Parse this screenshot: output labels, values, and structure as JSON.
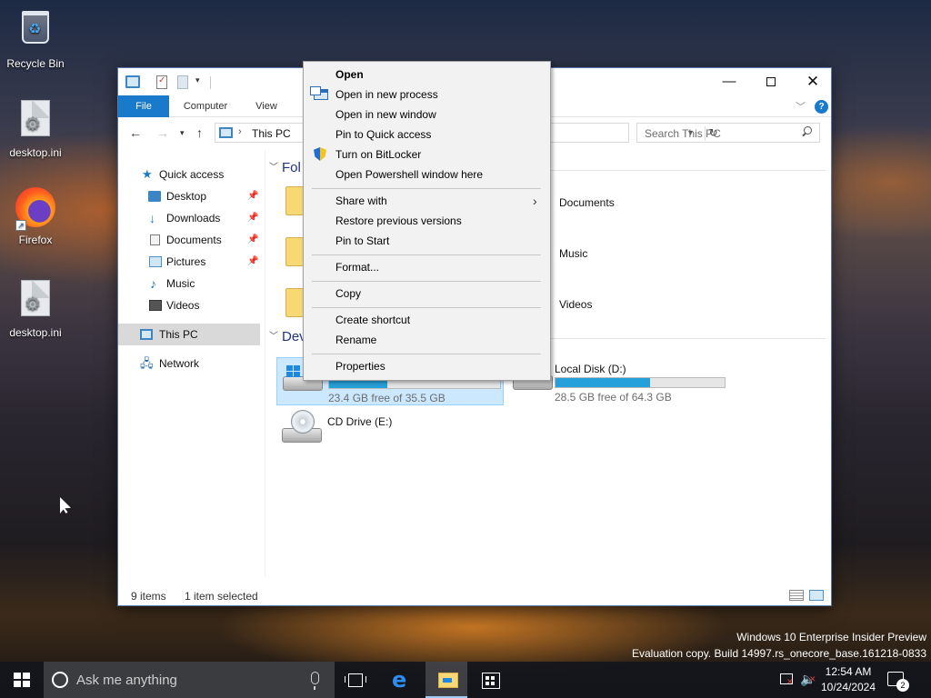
{
  "desktop": {
    "icons": [
      {
        "label": "Recycle Bin"
      },
      {
        "label": "desktop.ini"
      },
      {
        "label": "Firefox"
      },
      {
        "label": "desktop.ini"
      }
    ]
  },
  "explorer": {
    "ribbon_tabs": [
      "File",
      "Computer",
      "View"
    ],
    "address": {
      "path": "This PC"
    },
    "search": {
      "placeholder": "Search This PC"
    },
    "nav": {
      "quick_access": "Quick access",
      "items": [
        "Desktop",
        "Downloads",
        "Documents",
        "Pictures",
        "Music",
        "Videos"
      ],
      "this_pc": "This PC",
      "network": "Network"
    },
    "groups": {
      "folders_visible": "Fol",
      "devices_visible": "Dev"
    },
    "folders": [
      "Documents",
      "Music",
      "Videos"
    ],
    "drives": [
      {
        "name": "",
        "free": "23.4 GB free of 35.5 GB",
        "used_fraction": 0.34,
        "selected": true
      },
      {
        "name": "Local Disk (D:)",
        "free": "28.5 GB free of 64.3 GB",
        "used_fraction": 0.56,
        "selected": false
      },
      {
        "name": "CD Drive (E:)",
        "free": "",
        "selected": false
      }
    ],
    "status": {
      "items": "9 items",
      "selected": "1 item selected"
    }
  },
  "context_menu": {
    "items": [
      {
        "label": "Open",
        "bold": true
      },
      {
        "label": "Open in new process",
        "icon": "process-icon"
      },
      {
        "label": "Open in new window"
      },
      {
        "label": "Pin to Quick access"
      },
      {
        "label": "Turn on BitLocker",
        "icon": "shield-icon"
      },
      {
        "label": "Open Powershell window here"
      },
      {
        "label": "Share with",
        "submenu": true
      },
      {
        "label": "Restore previous versions"
      },
      {
        "label": "Pin to Start"
      },
      {
        "label": "Format..."
      },
      {
        "label": "Copy"
      },
      {
        "label": "Create shortcut"
      },
      {
        "label": "Rename"
      },
      {
        "label": "Properties"
      }
    ]
  },
  "watermark": {
    "line1": "Windows 10 Enterprise Insider Preview",
    "line2": "Evaluation copy. Build 14997.rs_onecore_base.161218-0833"
  },
  "taskbar": {
    "search_placeholder": "Ask me anything",
    "time": "12:54 AM",
    "date": "10/24/2024",
    "notification_count": "2"
  },
  "colors": {
    "accent": "#1979ca",
    "selection": "#cce8ff",
    "drive_bar": "#26a0da"
  }
}
